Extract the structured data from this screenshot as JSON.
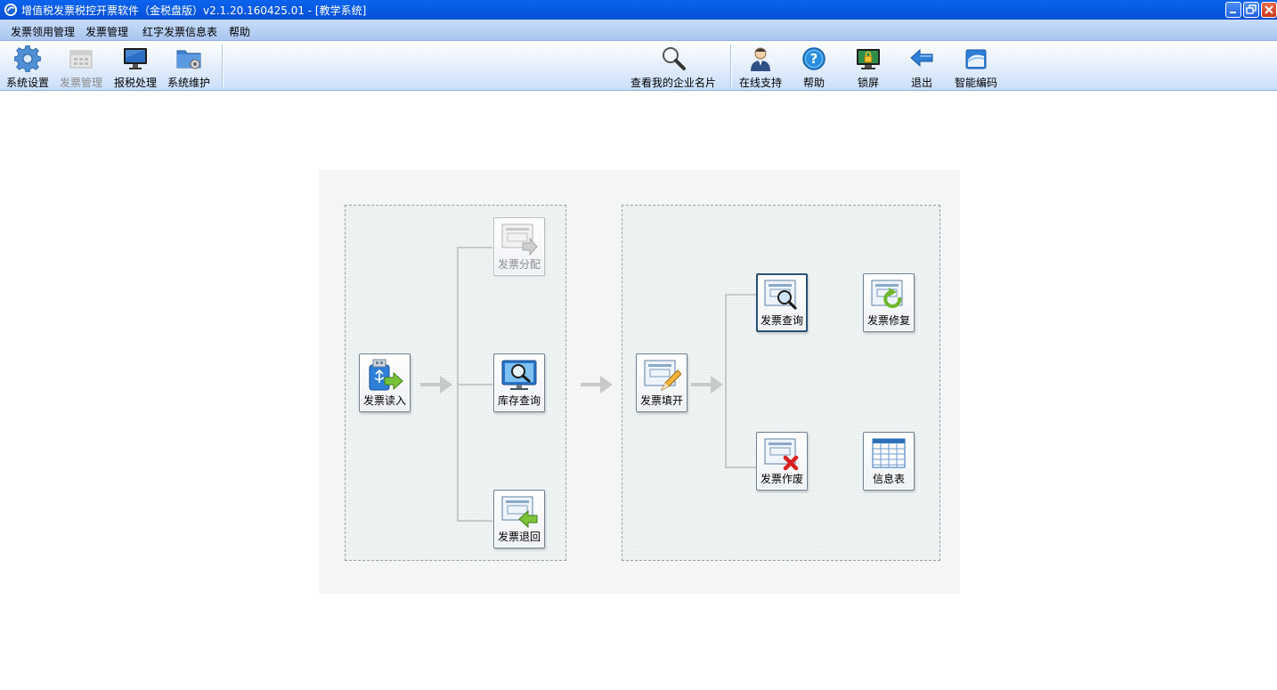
{
  "window": {
    "title": "增值税发票税控开票软件（金税盘版）v2.1.20.160425.01 - [教学系统]"
  },
  "menu": {
    "items": [
      {
        "label": "发票领用管理"
      },
      {
        "label": "发票管理"
      },
      {
        "label": "红字发票信息表"
      },
      {
        "label": "帮助"
      }
    ]
  },
  "toolbar": {
    "left": [
      {
        "label": "系统设置",
        "icon": "gear-icon",
        "enabled": true
      },
      {
        "label": "发票管理",
        "icon": "invoice-grid-icon",
        "enabled": false
      },
      {
        "label": "报税处理",
        "icon": "monitor-icon",
        "enabled": true
      },
      {
        "label": "系统维护",
        "icon": "folder-gear-icon",
        "enabled": true
      }
    ],
    "right": [
      {
        "label": "查看我的企业名片",
        "icon": "magnifier-icon"
      },
      {
        "label": "在线支持",
        "icon": "support-person-icon"
      },
      {
        "label": "帮助",
        "icon": "help-icon"
      },
      {
        "label": "锁屏",
        "icon": "lock-screen-icon"
      },
      {
        "label": "退出",
        "icon": "exit-arrow-icon"
      },
      {
        "label": "智能编码",
        "icon": "smart-code-icon"
      }
    ]
  },
  "flow": {
    "group1": {
      "read": {
        "label": "发票读入",
        "icon": "usb-import-icon"
      },
      "distribute": {
        "label": "发票分配",
        "icon": "invoice-distribute-icon",
        "enabled": false
      },
      "stock": {
        "label": "库存查询",
        "icon": "monitor-search-icon"
      },
      "return": {
        "label": "发票退回",
        "icon": "invoice-return-icon"
      }
    },
    "group2": {
      "fill": {
        "label": "发票填开",
        "icon": "invoice-write-icon"
      },
      "query": {
        "label": "发票查询",
        "icon": "invoice-search-icon",
        "selected": true
      },
      "repair": {
        "label": "发票修复",
        "icon": "invoice-repair-icon"
      },
      "void": {
        "label": "发票作废",
        "icon": "invoice-void-icon"
      },
      "info": {
        "label": "信息表",
        "icon": "table-icon"
      }
    }
  },
  "colors": {
    "titlebar": "#0650d6",
    "menubar": "#b8d0f5",
    "panel": "#f4f5f5",
    "connector": "#c7c9ca"
  }
}
